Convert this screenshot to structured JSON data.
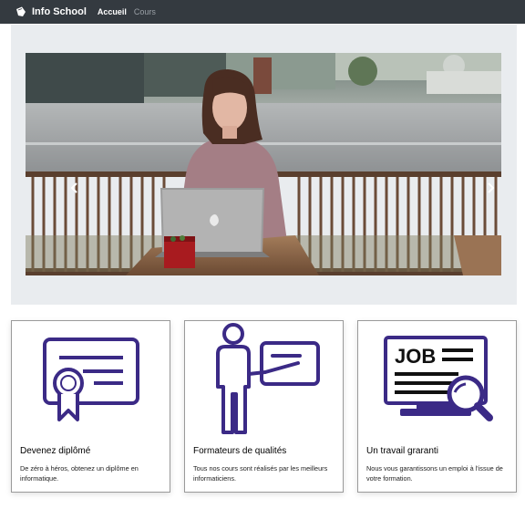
{
  "navbar": {
    "brand": "Info School",
    "links": [
      "Accueil",
      "Cours"
    ]
  },
  "carousel": {
    "image_alt": "Femme travaillant sur un ordinateur portable à une terrasse de café"
  },
  "cards": [
    {
      "icon": "diploma-certificate-icon",
      "title": "Devenez diplômé",
      "text": "De zéro à héros, obtenez un diplôme en informatique."
    },
    {
      "icon": "teacher-presentation-icon",
      "title": "Formateurs de qualités",
      "text": "Tous nos cours sont réalisés par les meilleurs informaticiens."
    },
    {
      "icon": "job-search-icon",
      "title": "Un travail graranti",
      "text": "Nous vous garantissons un emploi à l'issue de votre formation.",
      "icon_label": "JOB"
    }
  ],
  "colors": {
    "navbar_bg": "#343a40",
    "jumbotron_bg": "#e9ecef",
    "icon_purple": "#3b2a86"
  }
}
